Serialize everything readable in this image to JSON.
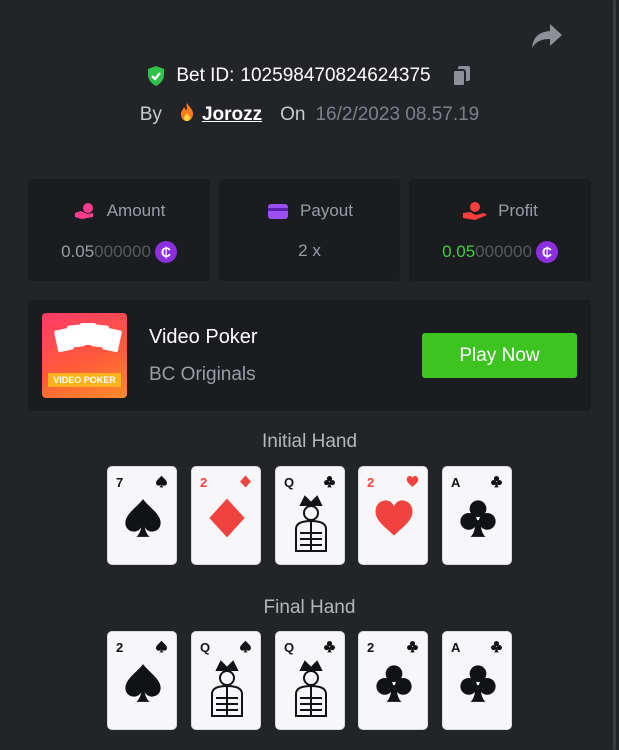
{
  "bet": {
    "label": "Bet ID:",
    "id": "102598470824624375"
  },
  "author": {
    "by_label": "By",
    "username": "Jorozz",
    "on_label": "On",
    "date": "16/2/2023 08.57.19"
  },
  "stats": {
    "amount": {
      "label": "Amount",
      "value_main": "0.05",
      "value_dim": "000000",
      "coin": "₵"
    },
    "payout": {
      "label": "Payout",
      "value": "2 x"
    },
    "profit": {
      "label": "Profit",
      "value_main": "0.05",
      "value_dim": "000000",
      "coin": "₵"
    }
  },
  "game": {
    "title": "Video Poker",
    "subtitle": "BC Originals",
    "thumb_text": "VIDEO POKER",
    "play_label": "Play Now"
  },
  "initial_hand": {
    "title": "Initial Hand",
    "cards": [
      {
        "rank": "7",
        "suit": "spades"
      },
      {
        "rank": "2",
        "suit": "diamonds"
      },
      {
        "rank": "Q",
        "suit": "clubs"
      },
      {
        "rank": "2",
        "suit": "hearts"
      },
      {
        "rank": "A",
        "suit": "clubs"
      }
    ]
  },
  "final_hand": {
    "title": "Final Hand",
    "cards": [
      {
        "rank": "2",
        "suit": "spades"
      },
      {
        "rank": "Q",
        "suit": "spades"
      },
      {
        "rank": "Q",
        "suit": "clubs"
      },
      {
        "rank": "2",
        "suit": "clubs"
      },
      {
        "rank": "A",
        "suit": "clubs"
      }
    ]
  },
  "colors": {
    "background": "#232427",
    "panel": "#1b1c1f",
    "accent_green": "#3ec421",
    "profit_green": "#3fcf3a",
    "coin_purple": "#8b2fe0",
    "red_suit": "#f0433f",
    "black_suit": "#111215"
  },
  "icons": {
    "share": "share-arrow-icon",
    "verified": "shield-check-icon",
    "copy": "copy-icon",
    "user_badge": "fire-icon",
    "amount": "coins-hand-icon",
    "payout": "wallet-card-icon",
    "profit": "money-hand-icon",
    "coin": "coin-icon"
  }
}
